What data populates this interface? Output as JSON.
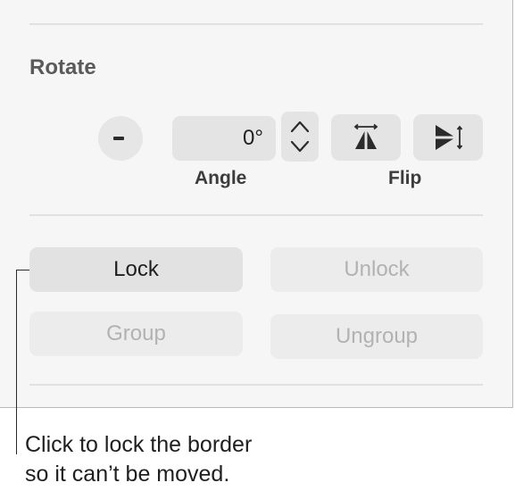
{
  "rotate": {
    "title": "Rotate",
    "angle_value": "0°",
    "angle_label": "Angle",
    "flip_label": "Flip"
  },
  "arrange": {
    "lock_label": "Lock",
    "unlock_label": "Unlock",
    "group_label": "Group",
    "ungroup_label": "Ungroup"
  },
  "callout": {
    "line1": "Click to lock the border",
    "line2": "so it can’t be moved."
  },
  "icons": {
    "rotate_knob": "rotation-dial-icon",
    "stepper_up": "chevron-up-icon",
    "stepper_down": "chevron-down-icon",
    "flip_horizontal": "flip-horizontal-icon",
    "flip_vertical": "flip-vertical-icon"
  },
  "colors": {
    "panel_bg": "#f6f6f6",
    "control_bg": "#e4e4e4",
    "disabled_text": "#b2b2b2"
  }
}
